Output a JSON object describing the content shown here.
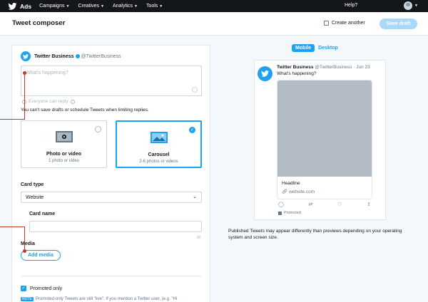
{
  "topnav": {
    "brand": "Ads",
    "items": [
      "Campaigns",
      "Creatives",
      "Analytics",
      "Tools"
    ],
    "help": "Help?"
  },
  "header": {
    "title": "Tweet composer",
    "create_another": "Create another",
    "save_draft": "Save draft"
  },
  "composer": {
    "account_name": "Twitter Business",
    "account_handle": "@TwitterBusiness",
    "placeholder": "What's happening?",
    "reply_setting": "Everyone can reply",
    "warning": "You can't save drafts or schedule Tweets when limiting replies.",
    "types": [
      {
        "title": "Photo or video",
        "sub": "1 photo or video",
        "selected": false
      },
      {
        "title": "Carousel",
        "sub": "2-6 photos or videos",
        "selected": true
      }
    ],
    "card_type_label": "Card type",
    "card_type_value": "Website",
    "card_name_label": "Card name",
    "card_name_counter": "80",
    "media_label": "Media",
    "add_media": "Add media",
    "promoted_only": "Promoted only",
    "note_badge": "NOTE",
    "note": "Promoted-only Tweets are still \"live\". If you mention a Twitter user, (e.g. \"Hi"
  },
  "preview": {
    "tabs": [
      "Mobile",
      "Desktop"
    ],
    "name": "Twitter Business",
    "handle_date": "@TwitterBusiness · Jun 23",
    "text": "What's happening?",
    "headline": "Headline",
    "url": "website.com",
    "promoted": "Promoted",
    "disclaimer": "Published Tweets may appear differently than previews depending on your operating system and screen size."
  },
  "colors": {
    "accent": "#1da1f2",
    "annotation": "#c0392b",
    "nav_bg": "#14171a"
  }
}
